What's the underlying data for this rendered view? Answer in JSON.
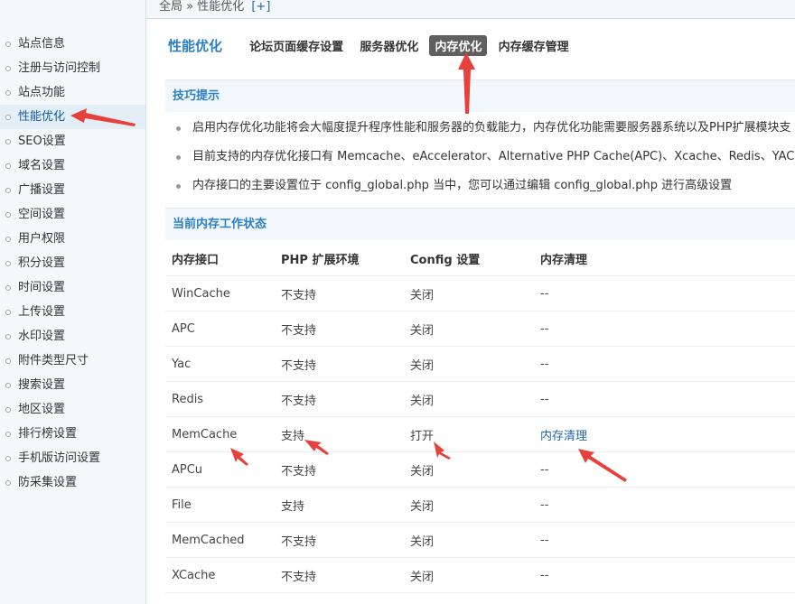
{
  "breadcrumb": {
    "text": "全局 » 性能优化",
    "plus": "[+]"
  },
  "sidebar": {
    "items": [
      {
        "label": "站点信息"
      },
      {
        "label": "注册与访问控制"
      },
      {
        "label": "站点功能"
      },
      {
        "label": "性能优化",
        "active": true
      },
      {
        "label": "SEO设置"
      },
      {
        "label": "域名设置"
      },
      {
        "label": "广播设置"
      },
      {
        "label": "空间设置"
      },
      {
        "label": "用户权限"
      },
      {
        "label": "积分设置"
      },
      {
        "label": "时间设置"
      },
      {
        "label": "上传设置"
      },
      {
        "label": "水印设置"
      },
      {
        "label": "附件类型尺寸"
      },
      {
        "label": "搜索设置"
      },
      {
        "label": "地区设置"
      },
      {
        "label": "排行榜设置"
      },
      {
        "label": "手机版访问设置"
      },
      {
        "label": "防采集设置"
      }
    ]
  },
  "header": {
    "title": "性能优化",
    "tabs": [
      {
        "label": "论坛页面缓存设置"
      },
      {
        "label": "服务器优化"
      },
      {
        "label": "内存优化",
        "current": true
      },
      {
        "label": "内存缓存管理"
      }
    ]
  },
  "tips": {
    "heading": "技巧提示",
    "items": [
      "启用内存优化功能将会大幅度提升程序性能和服务器的负载能力，内存优化功能需要服务器系统以及PHP扩展模块支",
      "目前支持的内存优化接口有 Memcache、eAccelerator、Alternative PHP Cache(APC)、Xcache、Redis、YAC",
      "内存接口的主要设置位于 config_global.php 当中，您可以通过编辑 config_global.php 进行高级设置"
    ]
  },
  "status": {
    "heading": "当前内存工作状态",
    "columns": [
      "内存接口",
      "PHP 扩展环境",
      "Config 设置",
      "内存清理"
    ],
    "rows": [
      {
        "name": "WinCache",
        "php": "不支持",
        "config": "关闭",
        "clean": "--"
      },
      {
        "name": "APC",
        "php": "不支持",
        "config": "关闭",
        "clean": "--"
      },
      {
        "name": "Yac",
        "php": "不支持",
        "config": "关闭",
        "clean": "--"
      },
      {
        "name": "Redis",
        "php": "不支持",
        "config": "关闭",
        "clean": "--"
      },
      {
        "name": "MemCache",
        "php": "支持",
        "config": "打开",
        "clean": "内存清理",
        "clean_link": true
      },
      {
        "name": "APCu",
        "php": "不支持",
        "config": "关闭",
        "clean": "--"
      },
      {
        "name": "File",
        "php": "支持",
        "config": "关闭",
        "clean": "--"
      },
      {
        "name": "MemCached",
        "php": "不支持",
        "config": "关闭",
        "clean": "--"
      },
      {
        "name": "XCache",
        "php": "不支持",
        "config": "关闭",
        "clean": "--"
      }
    ]
  },
  "colors": {
    "accent": "#2b80c5",
    "link": "#2366a8",
    "annotation_arrow": "#e8403a"
  }
}
